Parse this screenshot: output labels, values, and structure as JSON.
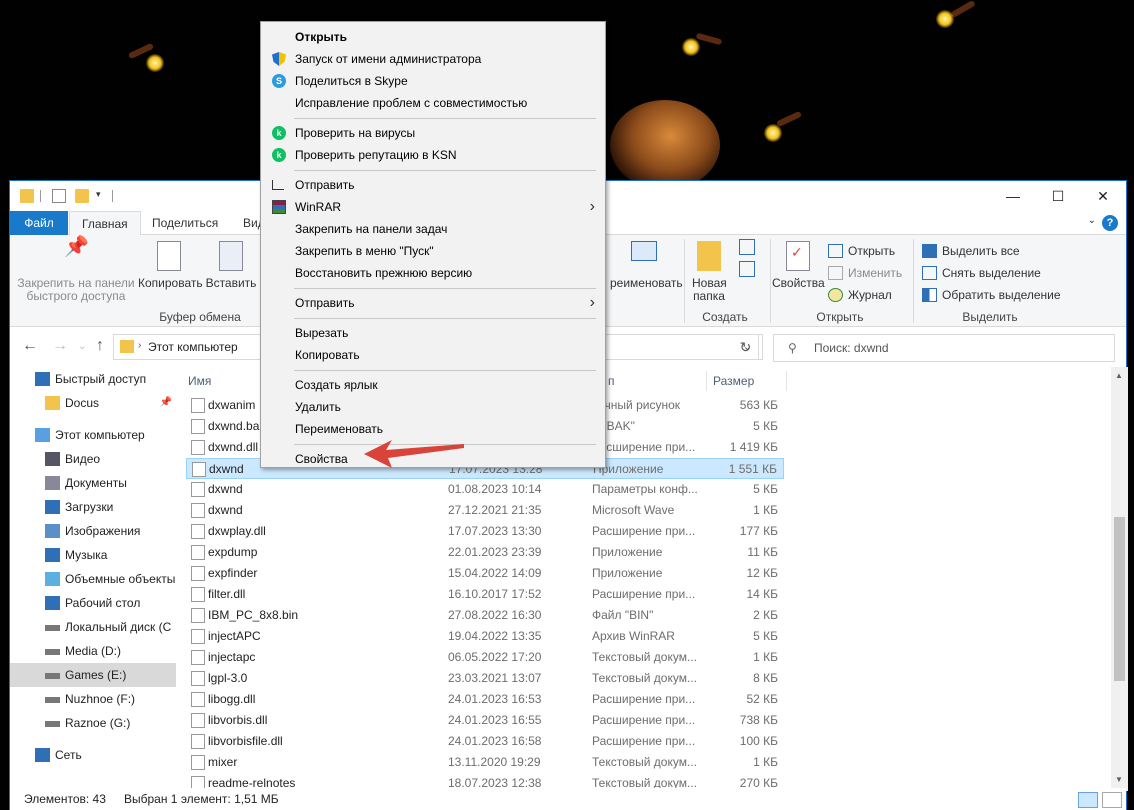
{
  "window": {
    "ribbon_tabs": [
      "Файл",
      "Главная",
      "Поделиться",
      "Вид"
    ],
    "controls": {
      "minimize": "—",
      "maximize": "☐",
      "close": "✕"
    }
  },
  "ribbon": {
    "clipboard": {
      "pin_label": "Закрепить на панели быстрого доступа",
      "copy_label": "Копировать",
      "paste_label": "Вставить",
      "group_label": "Буфер обмена"
    },
    "partial_move_label": "реименовать",
    "create": {
      "new_folder_label": "Новая папка",
      "group_label": "Создать"
    },
    "open": {
      "properties_label": "Свойства",
      "open_label": "Открыть",
      "edit_label": "Изменить",
      "history_label": "Журнал",
      "group_label": "Открыть"
    },
    "select": {
      "select_all_label": "Выделить все",
      "select_none_label": "Снять выделение",
      "invert_label": "Обратить выделение",
      "group_label": "Выделить"
    }
  },
  "address": {
    "breadcrumb": "Этот компьютер",
    "search_placeholder": "Поиск: dxwnd"
  },
  "navpane": {
    "items": [
      {
        "label": "Быстрый доступ",
        "icon": "star-icon",
        "level": 0
      },
      {
        "label": "Docus",
        "icon": "folder-icon",
        "level": 1
      },
      {
        "label": "Этот компьютер",
        "icon": "computer-icon",
        "level": 0
      },
      {
        "label": "Видео",
        "icon": "video-icon",
        "level": 1
      },
      {
        "label": "Документы",
        "icon": "documents-icon",
        "level": 1
      },
      {
        "label": "Загрузки",
        "icon": "download-icon",
        "level": 1
      },
      {
        "label": "Изображения",
        "icon": "pictures-icon",
        "level": 1
      },
      {
        "label": "Музыка",
        "icon": "music-icon",
        "level": 1
      },
      {
        "label": "Объемные объекты",
        "icon": "cube-icon",
        "level": 1
      },
      {
        "label": "Рабочий стол",
        "icon": "desktop-icon",
        "level": 1
      },
      {
        "label": "Локальный диск (C",
        "icon": "drive-icon",
        "level": 1
      },
      {
        "label": "Media (D:)",
        "icon": "drive-icon",
        "level": 1
      },
      {
        "label": "Games (E:)",
        "icon": "drive-icon",
        "level": 1
      },
      {
        "label": "Nuzhnoe (F:)",
        "icon": "drive-icon",
        "level": 1
      },
      {
        "label": "Raznoe (G:)",
        "icon": "drive-icon",
        "level": 1
      },
      {
        "label": "Сеть",
        "icon": "network-icon",
        "level": 0
      }
    ]
  },
  "filelist": {
    "headers": {
      "name": "Имя",
      "type": "п",
      "size": "Размер"
    },
    "rows": [
      {
        "name": "dxwanim",
        "date": "",
        "type": "чечный рисунок",
        "size": "563 КБ"
      },
      {
        "name": "dxwnd.ba",
        "date": "",
        "type": "л \"BAK\"",
        "size": "5 КБ"
      },
      {
        "name": "dxwnd.dll",
        "date": "",
        "type": "Расширение при...",
        "size": "1 419 КБ"
      },
      {
        "name": "dxwnd",
        "date": "17.07.2023 13:28",
        "type": "Приложение",
        "size": "1 551 КБ"
      },
      {
        "name": "dxwnd",
        "date": "01.08.2023 10:14",
        "type": "Параметры конф...",
        "size": "5 КБ"
      },
      {
        "name": "dxwnd",
        "date": "27.12.2021 21:35",
        "type": "Microsoft Wave",
        "size": "1 КБ"
      },
      {
        "name": "dxwplay.dll",
        "date": "17.07.2023 13:30",
        "type": "Расширение при...",
        "size": "177 КБ"
      },
      {
        "name": "expdump",
        "date": "22.01.2023 23:39",
        "type": "Приложение",
        "size": "11 КБ"
      },
      {
        "name": "expfinder",
        "date": "15.04.2022 14:09",
        "type": "Приложение",
        "size": "12 КБ"
      },
      {
        "name": "filter.dll",
        "date": "16.10.2017 17:52",
        "type": "Расширение при...",
        "size": "14 КБ"
      },
      {
        "name": "IBM_PC_8x8.bin",
        "date": "27.08.2022 16:30",
        "type": "Файл \"BIN\"",
        "size": "2 КБ"
      },
      {
        "name": "injectAPC",
        "date": "19.04.2022 13:35",
        "type": "Архив WinRAR",
        "size": "5 КБ"
      },
      {
        "name": "injectapc",
        "date": "06.05.2022 17:20",
        "type": "Текстовый докум...",
        "size": "1 КБ"
      },
      {
        "name": "lgpl-3.0",
        "date": "23.03.2021 13:07",
        "type": "Текстовый докум...",
        "size": "8 КБ"
      },
      {
        "name": "libogg.dll",
        "date": "24.01.2023 16:53",
        "type": "Расширение при...",
        "size": "52 КБ"
      },
      {
        "name": "libvorbis.dll",
        "date": "24.01.2023 16:55",
        "type": "Расширение при...",
        "size": "738 КБ"
      },
      {
        "name": "libvorbisfile.dll",
        "date": "24.01.2023 16:58",
        "type": "Расширение при...",
        "size": "100 КБ"
      },
      {
        "name": "mixer",
        "date": "13.11.2020 19:29",
        "type": "Текстовый докум...",
        "size": "1 КБ"
      },
      {
        "name": "readme-relnotes",
        "date": "18.07.2023 12:38",
        "type": "Текстовый докум...",
        "size": "270 КБ"
      }
    ]
  },
  "status": {
    "count": "Элементов: 43",
    "selection": "Выбран 1 элемент: 1,51 МБ"
  },
  "context_menu": {
    "groups": [
      [
        {
          "label": "Открыть",
          "bold": true,
          "icon": ""
        },
        {
          "label": "Запуск от имени администратора",
          "icon": "uac-shield-icon"
        },
        {
          "label": "Поделиться в Skype",
          "icon": "skype-icon"
        },
        {
          "label": "Исправление проблем с совместимостью",
          "icon": ""
        }
      ],
      [
        {
          "label": "Проверить на вирусы",
          "icon": "kaspersky-icon"
        },
        {
          "label": "Проверить репутацию в KSN",
          "icon": "kaspersky-icon"
        }
      ],
      [
        {
          "label": "Отправить",
          "icon": "share-icon"
        },
        {
          "label": "WinRAR",
          "icon": "winrar-icon",
          "submenu": true
        },
        {
          "label": "Закрепить на панели задач",
          "icon": ""
        },
        {
          "label": "Закрепить в меню \"Пуск\"",
          "icon": ""
        },
        {
          "label": "Восстановить прежнюю версию",
          "icon": ""
        }
      ],
      [
        {
          "label": "Отправить",
          "icon": "",
          "submenu": true
        }
      ],
      [
        {
          "label": "Вырезать",
          "icon": ""
        },
        {
          "label": "Копировать",
          "icon": ""
        }
      ],
      [
        {
          "label": "Создать ярлык",
          "icon": ""
        },
        {
          "label": "Удалить",
          "icon": ""
        },
        {
          "label": "Переименовать",
          "icon": ""
        }
      ],
      [
        {
          "label": "Свойства",
          "icon": ""
        }
      ]
    ]
  },
  "colors": {
    "accent": "#1979ca",
    "selection_bg": "#cce8ff",
    "annotation_arrow": "#d9443a"
  }
}
